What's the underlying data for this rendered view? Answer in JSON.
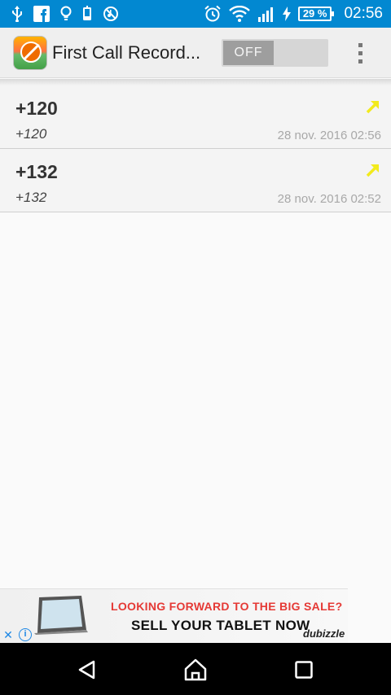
{
  "status_bar": {
    "icons_left": [
      "usb-icon",
      "facebook-icon",
      "lightbulb-icon",
      "phone-charge-icon",
      "no-music-icon"
    ],
    "icons_right": [
      "alarm-icon",
      "wifi-icon",
      "signal-icon",
      "charging-icon"
    ],
    "battery": "29 %",
    "time": "02:56",
    "bg_color": "#0288d1"
  },
  "app_bar": {
    "title": "First Call Record...",
    "toggle_label": "OFF"
  },
  "calls": [
    {
      "number": "+120",
      "name": "+120",
      "date": "28 nov. 2016  02:56",
      "direction": "outgoing"
    },
    {
      "number": "+132",
      "name": "+132",
      "date": "28 nov. 2016  02:52",
      "direction": "outgoing"
    }
  ],
  "ad": {
    "line1": "LOOKING FORWARD TO THE BIG SALE?",
    "line2": "SELL YOUR TABLET NOW",
    "brand": "dubizzle",
    "close": "✕",
    "info": "i"
  },
  "colors": {
    "accent_arrow": "#f2ea1c",
    "ad_headline": "#e53935"
  }
}
